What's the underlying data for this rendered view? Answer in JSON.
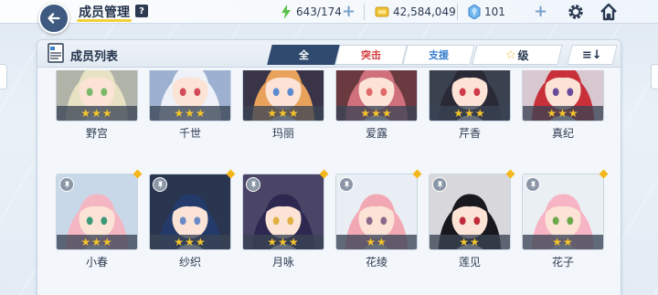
{
  "header": {
    "title": "成员管理",
    "help_label": "?",
    "ap": "643/174",
    "credits": "42,584,049",
    "gems": "101",
    "plus": "+",
    "accent": "#f2d03a"
  },
  "panel": {
    "title": "成员列表",
    "filters": [
      {
        "label": "全",
        "state": "active"
      },
      {
        "label": "突击",
        "state": "inactive"
      },
      {
        "label": "支援",
        "state": "inactive"
      }
    ],
    "sort_label": "级",
    "sort_star": "☆",
    "order_label": "≡↓"
  },
  "members": [
    {
      "name": "野宫",
      "stars": "★★★",
      "hair": "#e8e2c4",
      "eye": "#7bb96a",
      "bg": "#b0b4a8"
    },
    {
      "name": "千世",
      "stars": "★★★",
      "hair": "#eef1f8",
      "eye": "#d44a5a",
      "bg": "#9eb0d0"
    },
    {
      "name": "玛丽",
      "stars": "★★★",
      "hair": "#e9a25c",
      "eye": "#5a8ad0",
      "bg": "#3a3448"
    },
    {
      "name": "爱露",
      "stars": "★★★",
      "hair": "#d0707c",
      "eye": "#e06a6a",
      "bg": "#6a3a40"
    },
    {
      "name": "芹香",
      "stars": "★★★",
      "hair": "#2a2a36",
      "eye": "#d03a4a",
      "bg": "#3a4250"
    },
    {
      "name": "真纪",
      "stars": "★★★",
      "hair": "#c8303a",
      "eye": "#6a4a9a",
      "bg": "#d8c8d0"
    },
    {
      "name": "小春",
      "stars": "★★★",
      "hair": "#f4b6c2",
      "eye": "#3a9a7a",
      "bg": "#c8d8e8"
    },
    {
      "name": "纱织",
      "stars": "★★★",
      "hair": "#243a6a",
      "eye": "#6a8ac8",
      "bg": "#2a3650"
    },
    {
      "name": "月咏",
      "stars": "★★★",
      "hair": "#2e2850",
      "eye": "#e0b040",
      "bg": "#4a4466"
    },
    {
      "name": "花绫",
      "stars": "★★",
      "hair": "#f2a8b4",
      "eye": "#8a6a8a",
      "bg": "#e8eef4"
    },
    {
      "name": "莲见",
      "stars": "★★",
      "hair": "#18181e",
      "eye": "#c02a3a",
      "bg": "#d8d8dc"
    },
    {
      "name": "花子",
      "stars": "★★",
      "hair": "#f7b4c4",
      "eye": "#6aa84a",
      "bg": "#eaeff4"
    }
  ]
}
